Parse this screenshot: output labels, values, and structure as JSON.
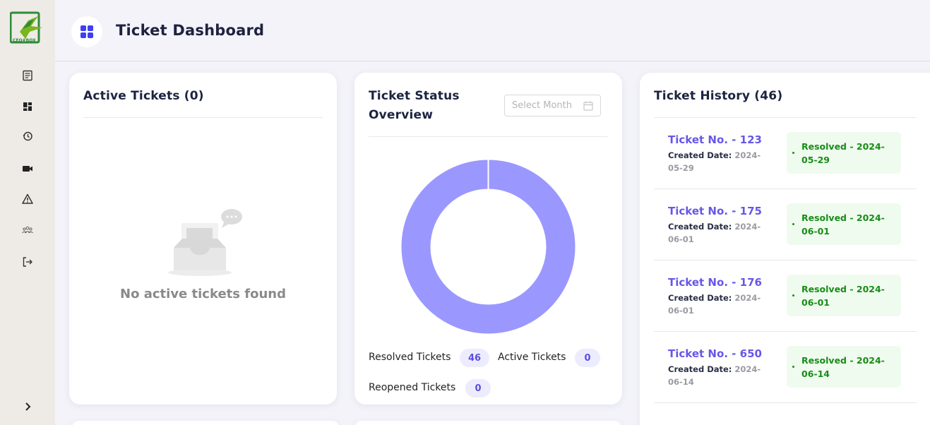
{
  "brand": {
    "logo_text": "CEO#BOX"
  },
  "sidebar": {
    "items": [
      {
        "icon": "document-icon"
      },
      {
        "icon": "dashboard-icon"
      },
      {
        "icon": "history-icon"
      },
      {
        "icon": "video-icon"
      },
      {
        "icon": "warning-icon"
      },
      {
        "icon": "team-icon"
      },
      {
        "icon": "logout-icon"
      }
    ],
    "expand_icon": "chevron-right-icon"
  },
  "header": {
    "title": "Ticket Dashboard",
    "icon": "dashboard-icon"
  },
  "active_tickets": {
    "title": "Active Tickets (0)",
    "empty_message": "No active tickets found"
  },
  "status_overview": {
    "title_line1": "Ticket Status",
    "title_line2": "Overview",
    "month_placeholder": "Select Month",
    "resolved_label": "Resolved Tickets",
    "resolved_count": "46",
    "active_label": "Active Tickets",
    "active_count": "0",
    "reopened_label": "Reopened Tickets",
    "reopened_count": "0",
    "chart_color": "#9a98fe"
  },
  "chart_data": {
    "type": "pie",
    "categories": [
      "Resolved Tickets",
      "Active Tickets",
      "Reopened Tickets"
    ],
    "values": [
      46,
      0,
      0
    ],
    "title": ""
  },
  "history": {
    "title": "Ticket History (46)",
    "created_label": "Created Date:",
    "tickets": [
      {
        "number": "Ticket No. - 123",
        "date_line1": "2024-",
        "date_line2": "05-29",
        "status_line1": "Resolved - 2024-",
        "status_line2": "05-29"
      },
      {
        "number": "Ticket No. - 175",
        "date_line1": "2024-",
        "date_line2": "06-01",
        "status_line1": "Resolved - 2024-",
        "status_line2": "06-01"
      },
      {
        "number": "Ticket No. - 176",
        "date_line1": "2024-",
        "date_line2": "06-01",
        "status_line1": "Resolved - 2024-",
        "status_line2": "06-01"
      },
      {
        "number": "Ticket No. - 650",
        "date_line1": "2024-",
        "date_line2": "06-14",
        "status_line1": "Resolved - 2024-",
        "status_line2": "06-14"
      }
    ]
  },
  "colors": {
    "accent": "#3d3ff0",
    "ticket_link": "#6657e8",
    "resolved_green": "#198c19",
    "resolved_bg": "#effbee"
  }
}
